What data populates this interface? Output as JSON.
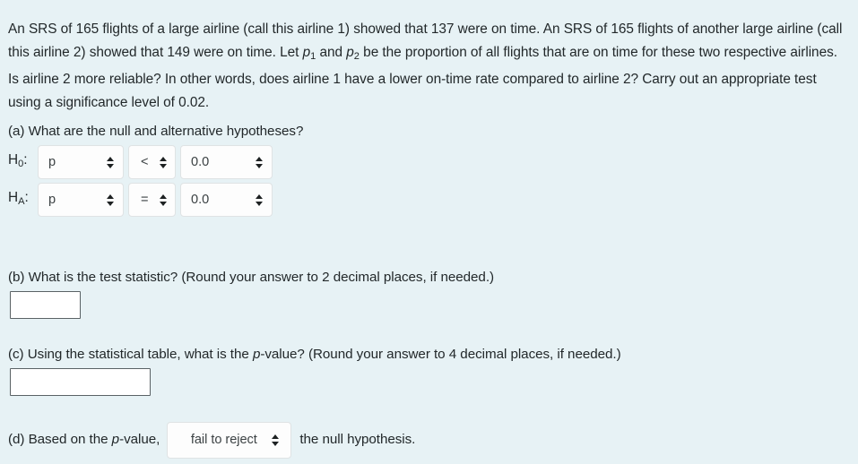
{
  "problem": {
    "text_parts": [
      "An SRS of 165 flights of a large airline (call this airline 1) showed that 137 were on time. An SRS of 165 flights of another large airline (call this airline 2) showed that 149 were on time. Let ",
      "p",
      "1",
      " and ",
      "p",
      "2",
      " be the proportion of all flights that are on time for these two respective airlines. Is airline 2 more reliable? In other words, does airline 1 have a lower on-time rate compared to airline 2? Carry out an appropriate test using a significance level of 0.02."
    ],
    "sample_size_1": "165",
    "on_time_1": "137",
    "sample_size_2": "165",
    "on_time_2": "149",
    "significance_level": "0.02"
  },
  "part_a": {
    "question": "(a) What are the null and alternative hypotheses?",
    "null_row": {
      "label_base": "H",
      "label_sub": "0",
      "label_colon": ":",
      "parameter": "p",
      "operator": "<",
      "value": "0.0"
    },
    "alt_row": {
      "label_base": "H",
      "label_sub": "A",
      "label_colon": ":",
      "parameter": "p",
      "operator": "=",
      "value": "0.0"
    }
  },
  "part_b": {
    "question_prefix": "(b) What is the test statistic? (Round your answer to 2 decimal places, if needed.)",
    "answer_value": "",
    "answer_placeholder": ""
  },
  "part_c": {
    "question_pre": "(c) Using the statistical table, what is the ",
    "question_italic": "p",
    "question_post": "-value? (Round your answer to 4 decimal places, if needed.)",
    "answer_value": "",
    "answer_placeholder": ""
  },
  "part_d": {
    "prefix_pre": "(d) Based on the ",
    "prefix_italic": "p",
    "prefix_post": "-value,",
    "decision": "fail to reject",
    "suffix": "the null hypothesis."
  },
  "colors": {
    "page_background": "#e7f2f5",
    "text": "#22282a",
    "select_background": "#fdfdfd",
    "select_border": "#dfe3e4",
    "input_border": "#5a6265",
    "input_background": "#ffffff",
    "caret": "#1d2122"
  }
}
